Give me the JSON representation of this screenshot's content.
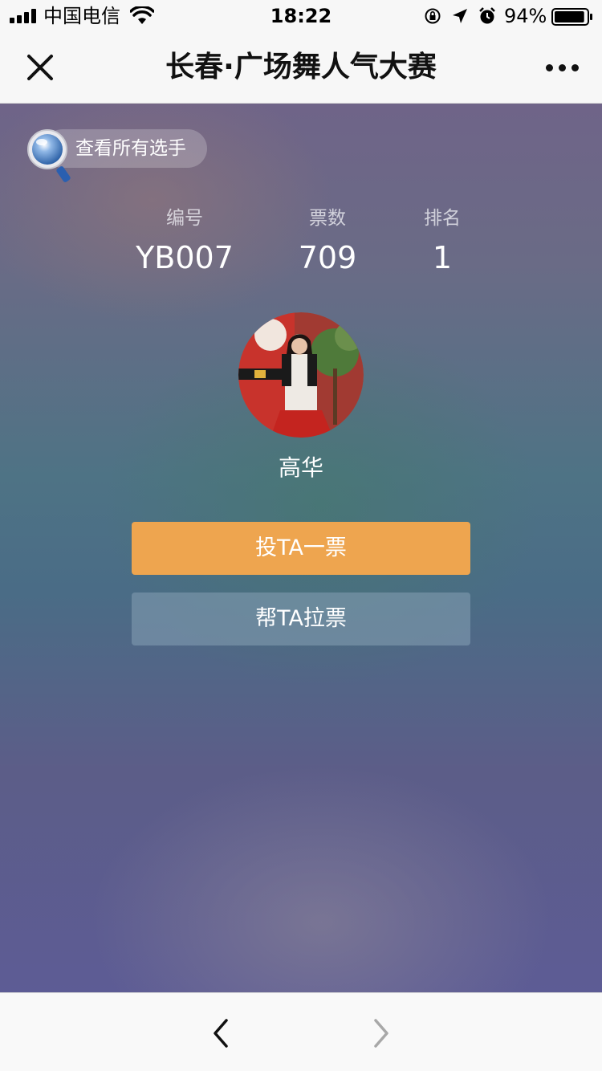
{
  "status_bar": {
    "carrier": "中国电信",
    "time": "18:22",
    "battery_percent": "94%",
    "battery_level": 0.94,
    "icons": [
      "signal-icon",
      "wifi-icon",
      "orientation-lock-icon",
      "location-icon",
      "alarm-icon",
      "battery-icon"
    ]
  },
  "nav": {
    "title": "长春·广场舞人气大赛",
    "close_icon": "close-icon",
    "more_icon": "more-icon"
  },
  "main": {
    "all_players_label": "查看所有选手",
    "stats": [
      {
        "label": "编号",
        "value": "YB007"
      },
      {
        "label": "票数",
        "value": "709"
      },
      {
        "label": "排名",
        "value": "1"
      }
    ],
    "player_name": "高华",
    "vote_button": "投TA一票",
    "canvass_button": "帮TA拉票"
  },
  "bottom_bar": {
    "back_icon": "chevron-left-icon",
    "forward_icon": "chevron-right-icon"
  },
  "colors": {
    "vote_button": "#eea54f",
    "canvass_button": "#7a93a8",
    "nav_background": "#f7f7f7"
  }
}
